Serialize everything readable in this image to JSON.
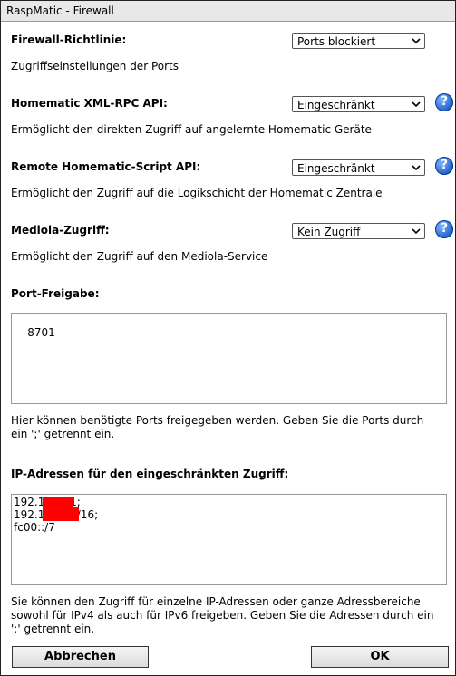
{
  "window": {
    "title": "RaspMatic - Firewall"
  },
  "sections": [
    {
      "label": "Firewall-Richtlinie:",
      "select_value": "Ports blockiert",
      "description": "Zugriffseinstellungen der Ports",
      "help": false
    },
    {
      "label": "Homematic XML-RPC API:",
      "select_value": "Eingeschränkt",
      "description": "Ermöglicht den direkten Zugriff auf angelernte Homematic Geräte",
      "help": true
    },
    {
      "label": "Remote Homematic-Script API:",
      "select_value": "Eingeschränkt",
      "description": "Ermöglicht den Zugriff auf die Logikschicht der Homematic Zentrale",
      "help": true
    },
    {
      "label": "Mediola-Zugriff:",
      "select_value": "Kein Zugriff",
      "description": "Ermöglicht den Zugriff auf den Mediola-Service",
      "help": true
    }
  ],
  "ports": {
    "label": "Port-Freigabe:",
    "value": "8701",
    "hint_line1": "Hier können benötigte Ports freigegeben werden. Geben Sie die Ports durch",
    "hint_line2": "ein ';' getrennt ein."
  },
  "ip": {
    "label": "IP-Adressen für den eingeschränkten Zugriff:",
    "lines": [
      "192.1",
      ".1;",
      "192.1",
      ".0/16;",
      "fc00::/7"
    ],
    "hint_line1": "Sie können den Zugriff für einzelne IP-Adressen oder ganze Adressbereiche",
    "hint_line2": "sowohl für IPv4 als auch für IPv6 freigeben. Geben Sie die Adressen durch ein",
    "hint_line3": "';' getrennt ein."
  },
  "buttons": {
    "cancel": "Abbrechen",
    "ok": "OK"
  },
  "icons": {
    "help": "help-icon",
    "dropdown": "chevron-down-icon"
  }
}
